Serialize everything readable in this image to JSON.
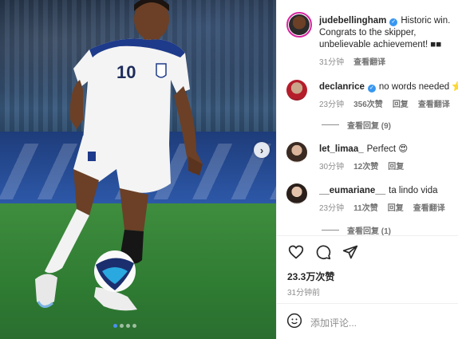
{
  "post": {
    "image_alt_icon": "football-player-photo",
    "next_icon": "chevron-right-icon",
    "carousel_dots": 4,
    "active_dot": 0
  },
  "caption": {
    "username": "judebellingham",
    "text_line1": "Historic win.",
    "text_line2": "Congrats to the skipper,",
    "text_line3": "unbelievable achievement! ■■",
    "time": "31分钟",
    "translate": "查看翻译"
  },
  "comments": [
    {
      "username": "declanrice",
      "verified": true,
      "text": "no words needed ⭐",
      "time": "23分钟",
      "likes": "356次赞",
      "reply": "回复",
      "translate": "查看翻译",
      "view_replies": "查看回复 (9)"
    },
    {
      "username": "let_limaa_",
      "verified": false,
      "text": "Perfect 😍",
      "time": "30分钟",
      "likes": "12次赞",
      "reply": "回复"
    },
    {
      "username": "__eumariane__",
      "verified": false,
      "text": "ta lindo vida",
      "time": "23分钟",
      "likes": "11次赞",
      "reply": "回复",
      "translate": "查看翻译",
      "view_replies": "查看回复 (1)"
    }
  ],
  "actions": {
    "like_icon": "heart-icon",
    "comment_icon": "comment-icon",
    "share_icon": "send-icon"
  },
  "stats": {
    "likes": "23.3万次赞",
    "posted": "31分钟前"
  },
  "add_comment": {
    "emoji_icon": "emoji-icon",
    "placeholder": "添加评论..."
  },
  "colors": {
    "verified": "#3897f0",
    "secondary_text": "#8e8e8e",
    "active_dot": "#4a90f0"
  }
}
